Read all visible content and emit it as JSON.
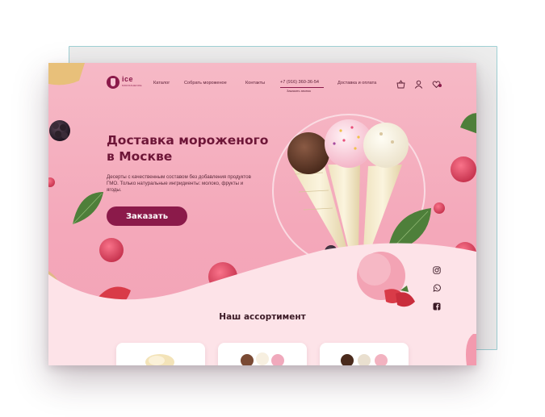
{
  "logo": {
    "name": "ice",
    "tagline": "MOROZHENOE"
  },
  "nav": {
    "items": [
      {
        "label": "Каталог"
      },
      {
        "label": "Собрать мороженое"
      },
      {
        "label": "Контакты"
      }
    ],
    "phone": "+7 (916) 360-36-54",
    "callback": "Заказать звонок",
    "delivery": "Доставка и оплата"
  },
  "header_icons": [
    "basket-icon",
    "user-icon",
    "heart-icon"
  ],
  "hero": {
    "title_line1": "Доставка мороженого",
    "title_line2": "в Москве",
    "description": "Десерты с качественным составом без добавления продуктов ГМО. Только натуральные ингридиенты: молоко, фрукты и ягоды.",
    "cta": "Заказать"
  },
  "social": [
    "instagram-icon",
    "whatsapp-icon",
    "facebook-icon"
  ],
  "assortment": {
    "title": "Наш ассортимент"
  },
  "colors": {
    "brand": "#8b1a4a",
    "background": "#f4a8ba",
    "lower": "#fde3e8"
  }
}
